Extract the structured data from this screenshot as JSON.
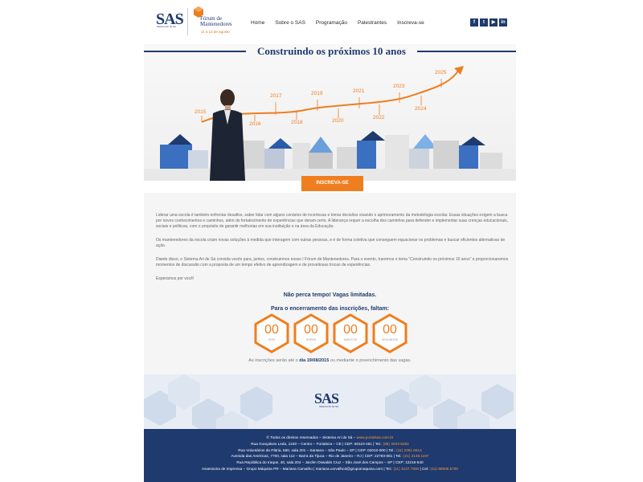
{
  "header": {
    "logo_text": "SAS",
    "logo_sub": "Sistema Ari de Sá",
    "forum_title": "Fórum de Mantenedores",
    "forum_date": "11 a 12 de agosto",
    "nav": [
      "Home",
      "Sobre o SAS",
      "Programação",
      "Palestrantes",
      "Inscreva-se"
    ],
    "social": [
      "facebook-icon",
      "twitter-icon",
      "youtube-icon",
      "linkedin-icon"
    ]
  },
  "hero": {
    "title": "Construindo os próximos 10 anos",
    "years_top": [
      "2015",
      "2017",
      "2019",
      "2021",
      "2023",
      "2025"
    ],
    "years_bottom": [
      "2016",
      "2018",
      "2020",
      "2022",
      "2024"
    ],
    "cta_label": "INSCREVA-SE"
  },
  "content": {
    "p1": "Liderar uma escola é também enfrentar desafios, saber lidar com alguns cenários de incertezas e tomar decisões visando o aprimoramento da metodologia escolar. Essas situações exigem a busca por novos conhecimentos e caminhos, além do fortalecimento de experiências que deram certo. A liderança requer a escolha dos caminhos para defender e implementar suas crenças educacionais, sociais e políticas, com o propósito de garantir melhorias em sua instituição e na área da Educação.",
    "p2": "Os mantenedores da escola criam novas soluções à medida que interagem com outras pessoas, e é de forma coletiva que conseguem equacionar os problemas e buscar eficientes alternativas de ação.",
    "p3": "Diante disso, o Sistema Ari de Sá convida vocês para, juntos, construirmos nosso I Fórum de Mantenedores. Para o evento, traremos o tema \"Construindo os próximos 10 anos\" e proporcionaremos momentos de discussão com a proposta de um tempo efetivo de aprendizagem e de proveitosas trocas de experiências.",
    "p4": "Esperamos por você!",
    "notice1": "Não perca tempo! Vagas limitadas.",
    "notice2": "Para o encerramento das inscrições, faltam:",
    "countdown": [
      {
        "value": "00",
        "label": "DIAS"
      },
      {
        "value": "00",
        "label": "HORAS"
      },
      {
        "value": "00",
        "label": "MINUTOS"
      },
      {
        "value": "00",
        "label": "SEGUNDOS"
      }
    ],
    "deadline_pre": "As inscrições serão até o",
    "deadline_date": "dia 19/08/2015",
    "deadline_post": "ou mediante o preenchimento das vagas."
  },
  "footer": {
    "logo_text": "SAS",
    "logo_sub": "Sistema Ari de Sá",
    "line1_text": "© Todos os direitos reservados – Sistema Ari de Sá –",
    "line1_link": "www.portalsas.com.br",
    "line2_text": "Rua Gonçalves Ledo, 1240 – Centro – Fortaleza – CE | CEP: 60110-261 | Tel.:",
    "line2_phone": "(85) 3033-8282",
    "line3_text": "Rua Voluntários da Pátria, 560, sala 201 – Santana – São Paulo – SP | CEP: 02010-000 | Tel.:",
    "line3_phone": "(11) 2361.6614",
    "line4_text": "Avenida das Américas, 7700, sala 112 – Barra da Tijuca – Rio de Janeiro – RJ | CEP: 22793-081 | Tel.:",
    "line4_phone": "(21) 2148.1197",
    "line5_text": "Rua República do Iraque, 40, sala 204 – Jardim Oswaldo Cruz – São José dos Campos – SP | CEP: 12216-540",
    "line6_text": "Assessoria de Imprensa – Grupo Máquina PR – Mariana Carvalho | mariana.carvalho3@grupomaquina.com | Tel.:",
    "line6_phone": "(11) 3147.7900",
    "line6_cel_label": "| Cel.:",
    "line6_cel": "(11) 98506.5700"
  },
  "colors": {
    "brand_navy": "#1f3a6e",
    "accent_orange": "#ee7e1e"
  }
}
